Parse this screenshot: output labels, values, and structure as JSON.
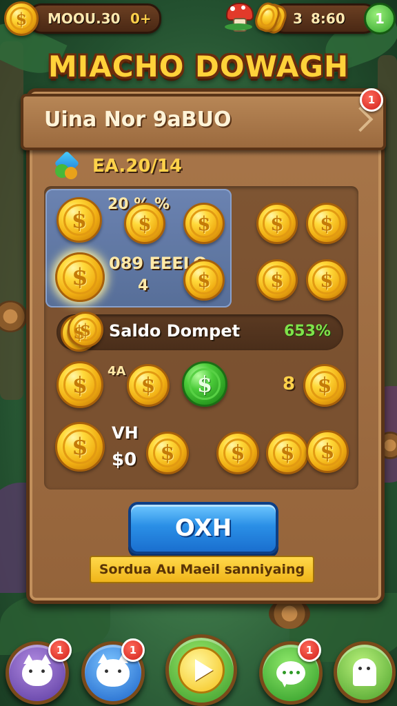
{
  "top_bar": {
    "left_label": "MOOU.30",
    "left_value": "0+",
    "right_a": "3",
    "right_b": "8:60",
    "right_badge": "1",
    "coin_symbol": "$"
  },
  "title": "MIACHO DOWAGH",
  "panel": {
    "header": "Uina Nor 9aBUO",
    "header_badge": "1",
    "date": "EA.20/14",
    "percent_top": "20 % %",
    "label_mid": "089 EEELO",
    "label_mid_sub": "4",
    "saldo_label": "Saldo Dompet",
    "saldo_value": "653%",
    "row3_label": "4A",
    "row3_num": "8",
    "vh_label": "VH",
    "vh_value": "$0",
    "ok_button": "OXH",
    "banner": "Sordua Au Maeil sanniyaing"
  },
  "nav": {
    "badge_1": "1",
    "badge_2": "1",
    "badge_4": "1"
  },
  "icons": [
    "coin-icon",
    "mushroom-icon",
    "coin-stack-icon",
    "check-icon",
    "heart-diamond-icon",
    "cat-icon",
    "play-icon",
    "chat-icon",
    "ghost-icon"
  ],
  "colors": {
    "gold": "#ffd23a",
    "wood": "#a9774a",
    "ok_blue": "#2a8fe6",
    "alert_red": "#d0201a",
    "green": "#4ccc3a"
  }
}
